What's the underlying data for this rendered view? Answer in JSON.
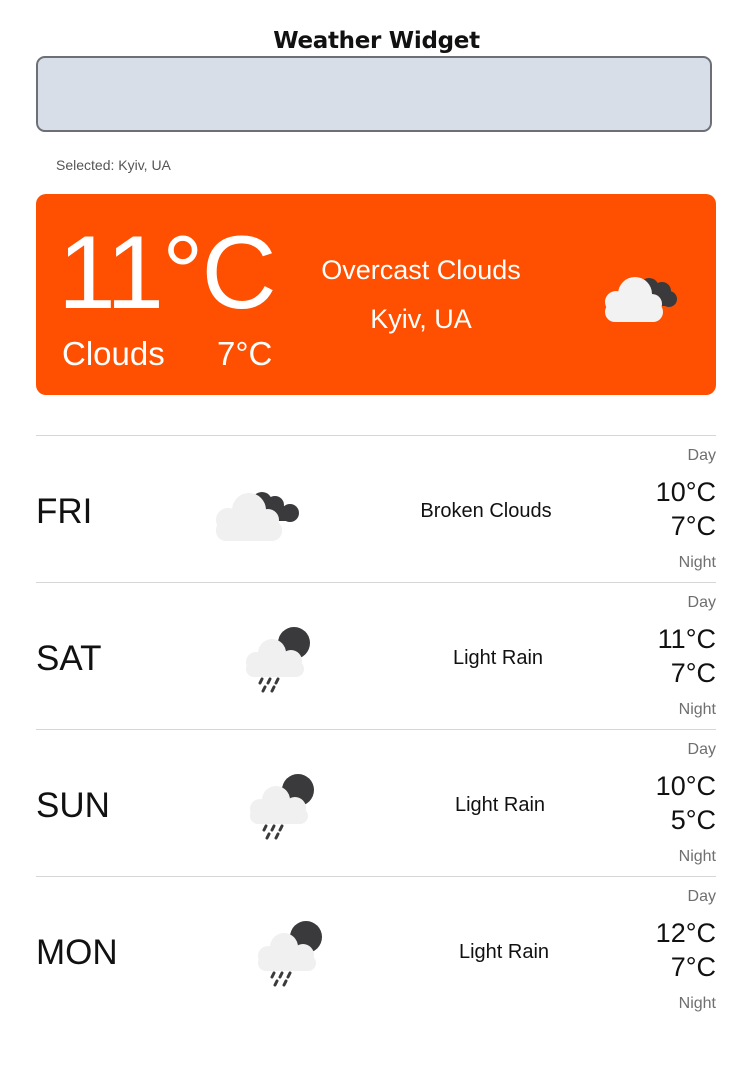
{
  "header": {
    "title": "Weather Widget"
  },
  "search": {
    "value": "",
    "selected_text": "Selected: Kyiv, UA"
  },
  "current": {
    "temp": "11°C",
    "main": "Clouds",
    "min_temp": "7°C",
    "description": "Overcast Clouds",
    "city": "Kyiv, UA",
    "icon": "overcast-clouds-icon",
    "card_color": "#fe5000"
  },
  "forecast": [
    {
      "day": "FRI",
      "description": "Broken Clouds",
      "high": "10°C",
      "low": "7°C",
      "day_label": "Day",
      "night_label": "Night",
      "icon": "broken-clouds-icon"
    },
    {
      "day": "SAT",
      "description": "Light Rain",
      "high": "11°C",
      "low": "7°C",
      "day_label": "Day",
      "night_label": "Night",
      "icon": "light-rain-icon"
    },
    {
      "day": "SUN",
      "description": "Light Rain",
      "high": "10°C",
      "low": "5°C",
      "day_label": "Day",
      "night_label": "Night",
      "icon": "light-rain-icon"
    },
    {
      "day": "MON",
      "description": "Light Rain",
      "high": "12°C",
      "low": "7°C",
      "day_label": "Day",
      "night_label": "Night",
      "icon": "light-rain-icon"
    }
  ]
}
